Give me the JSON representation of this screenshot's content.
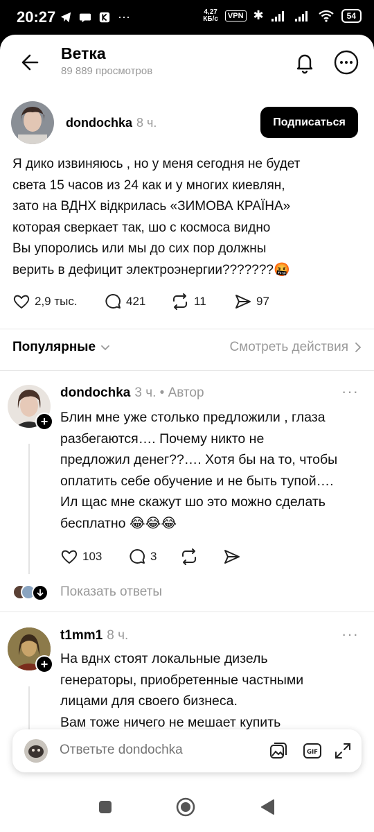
{
  "status_bar": {
    "time": "20:27",
    "speed_value": "4,27",
    "speed_unit": "КБ/с",
    "vpn": "VPN",
    "battery": "54"
  },
  "header": {
    "title": "Ветка",
    "views": "89 889 просмотров"
  },
  "post": {
    "username": "dondochka",
    "time": "8 ч.",
    "subscribe_label": "Подписаться",
    "lines": [
      "Я дико извиняюсь , но у меня сегодня не будет",
      "света 15 часов из 24 как и у многих киевлян,",
      "зато на ВДНХ відкрилась «ЗИМОВА КРАЇНА»",
      "которая сверкает так, шо с космоса видно",
      "Вы упоролись или мы до сих пор должны",
      "верить в  дефицит электроэнергии???????🤬"
    ],
    "likes": "2,9 тыс.",
    "comments": "421",
    "reposts": "11",
    "shares": "97"
  },
  "sort": {
    "label": "Популярные",
    "activity_link": "Смотреть действия"
  },
  "comments": [
    {
      "username": "dondochka",
      "meta": "3 ч. • Автор",
      "lines": [
        "Блин мне уже столько предложили , глаза",
        "разбегаются…. Почему никто не",
        "предложил денег??…. Хотя бы на то, чтобы",
        "оплатить себе обучение и не быть тупой….",
        "Ил щас мне скажут шо это можно сделать",
        "бесплатно 😂😂😂"
      ],
      "likes": "103",
      "replies": "3",
      "show_replies": "Показать ответы"
    },
    {
      "username": "t1mm1",
      "meta": "8 ч.",
      "lines": [
        "На вднх стоят локальные дизель",
        "генераторы, приобретенные частными",
        "лицами для своего бизнеса.",
        "Вам тоже ничего не мешает купить"
      ]
    }
  ],
  "reply": {
    "placeholder": "Ответьте dondochka"
  },
  "colors": {
    "accent": "#000000",
    "muted": "#999999",
    "background": "#ffffff"
  }
}
